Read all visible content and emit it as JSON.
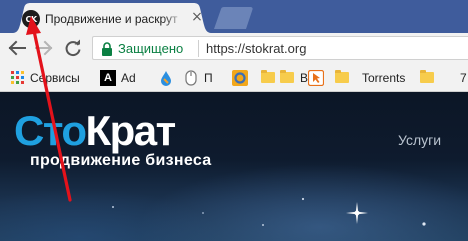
{
  "tab": {
    "favicon_text": "CK",
    "title": "Продвижение и раскрут",
    "close_symbol": "×"
  },
  "toolbar": {
    "secure_label": "Защищено",
    "url": "https://stokrat.org"
  },
  "bookmarks": [
    {
      "label": "Сервисы",
      "icon": "apps-grid-icon"
    },
    {
      "label": "Ad",
      "icon": "black-a-icon"
    },
    {
      "label": "",
      "icon": "drop-icon"
    },
    {
      "label": "П",
      "icon": "mouse-icon"
    },
    {
      "label": "",
      "icon": "orange-circle-icon"
    },
    {
      "label": "",
      "icon": "folder-icon"
    },
    {
      "label": "В",
      "icon": "folder-icon"
    },
    {
      "label": "",
      "icon": "cursor-icon"
    },
    {
      "label": "",
      "icon": "folder-icon"
    },
    {
      "label": "Torrents",
      "icon": "folder-icon"
    },
    {
      "label": "",
      "icon": "folder-icon"
    },
    {
      "label": "7",
      "icon": "folder-icon"
    }
  ],
  "site": {
    "logo_part1": "Сто",
    "logo_part2": "Крат",
    "slogan": "продвижение бизнеса",
    "nav_services": "Услуги"
  },
  "colors": {
    "accent_blue": "#1fa0e0",
    "tabstrip": "#3f5c9c",
    "secure_green": "#0b8043",
    "annotation_red": "#e3121b"
  }
}
